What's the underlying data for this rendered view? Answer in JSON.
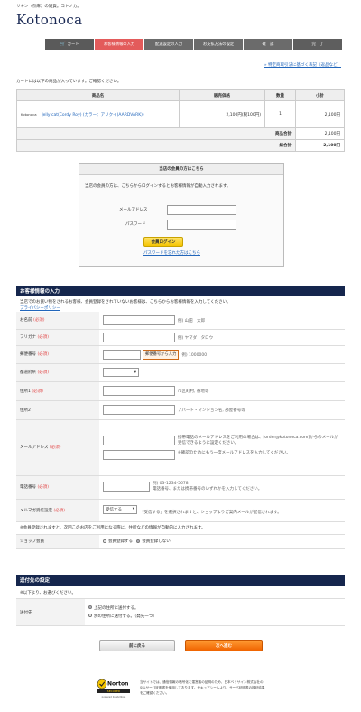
{
  "header": {
    "tagline": "リキン〈奈麻〉の雑貨。コトノカ。",
    "logo": "Kotonoca"
  },
  "steps": [
    "カート",
    "お客様情報の入力",
    "配送設定の入力",
    "お支払方法の設定",
    "確　認",
    "完　了"
  ],
  "legal_link": "» 特定商取引法に基づく表記（返品など）",
  "cart": {
    "note": "カートには以下の商品が入っています。ご確認ください。",
    "headers": [
      "商品名",
      "販売価格",
      "数量",
      "小計"
    ],
    "item": {
      "brand": "Kotonoca",
      "name": "Jelly cat(Cordy Roy) (カラー：アリクイ(AARDVARK))",
      "price": "2,100円(税100円)",
      "qty": "1",
      "subtotal": "2,100円"
    },
    "product_total_label": "商品合計",
    "product_total": "2,100円",
    "grand_total_label": "総合計",
    "grand_total": "2,100円"
  },
  "login": {
    "title": "当店の会員の方はこちら",
    "note": "当店の会員の方は、こちらからログインするとお客様情報が自動入力されます。",
    "email_label": "メールアドレス",
    "password_label": "パスワード",
    "button": "会員ログイン",
    "forgot": "パスワードを忘れた方はこちら"
  },
  "customer": {
    "title": "お客様情報の入力",
    "note": "当店でのお買い物をされるお客様、会員登録をされていないお客様は、こちらからお客様情報を入力してください。",
    "privacy": "プライバシーポリシー",
    "required": "(必須)",
    "name_label": "お名前",
    "name_hint": "例) 山田　太郎",
    "furigana_label": "フリガナ",
    "furigana_hint": "例) ヤマダ　タロウ",
    "zip_label": "郵便番号",
    "zip_button": "郵便番号から入力",
    "zip_hint": "例) 1000000",
    "pref_label": "都道府県",
    "addr1_label": "住所1",
    "addr1_hint": "市区町村, 番地等",
    "addr2_label": "住所2",
    "addr2_hint": "アパート・マンション名, 部屋番号等",
    "email_label": "メールアドレス",
    "email_note": "携帯電話のメールアドレスをご利用の場合は、[order@kotonoca.com]からのメールが受信できるように設定ください。",
    "email_confirm": "※確認のためにもう一度メールアドレスを入力してください。",
    "tel_label": "電話番号",
    "tel_hint": "例) 03-1234-5678",
    "tel_note": "電話番号、または携帯番号のいずれかを入力してください。",
    "mag_label": "メルマガ受信設定",
    "mag_value": "受信する",
    "mag_note": "「受信する」を選択されますと、ショップよりご案内メールが配信されます。",
    "member_note": "※会員登録されますと、次回このお店をご利用になる際に、住所などの情報が自動的に入力されます。",
    "shop_member_label": "ショップ会員",
    "shop_member_yes": "会員登録する",
    "shop_member_no": "会員登録しない"
  },
  "shipping": {
    "title": "送付先の設定",
    "note": "※以下より、お選びください。",
    "dest_label": "送付先",
    "opt1": "上記の住所に送付する。",
    "opt2": "別の住所に送付する。（発先一つ）"
  },
  "buttons": {
    "back": "前に戻る",
    "next": "次へ進む"
  },
  "norton": {
    "brand": "Norton",
    "secured": "SECURED",
    "powered": "powered by VeriSign",
    "text": "当サイトでは、通信情報の暗号化と運営者の証明のため、日本ベリサイン株式会社のSSLサーバ証明書を使用しております。セキュアシールより、サーバ証明書の検証結果をご確認ください。"
  }
}
